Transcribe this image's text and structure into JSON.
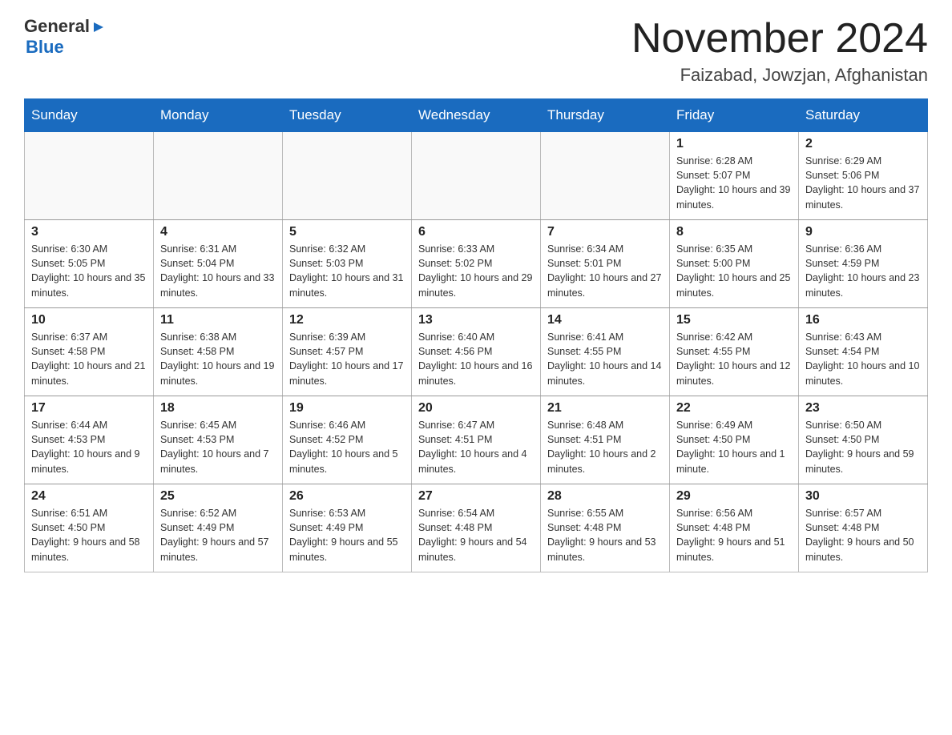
{
  "header": {
    "logo": {
      "general": "General",
      "triangle": "▶",
      "blue": "Blue"
    },
    "title": "November 2024",
    "location": "Faizabad, Jowzjan, Afghanistan"
  },
  "weekdays": [
    "Sunday",
    "Monday",
    "Tuesday",
    "Wednesday",
    "Thursday",
    "Friday",
    "Saturday"
  ],
  "weeks": [
    [
      {
        "day": "",
        "info": ""
      },
      {
        "day": "",
        "info": ""
      },
      {
        "day": "",
        "info": ""
      },
      {
        "day": "",
        "info": ""
      },
      {
        "day": "",
        "info": ""
      },
      {
        "day": "1",
        "info": "Sunrise: 6:28 AM\nSunset: 5:07 PM\nDaylight: 10 hours and 39 minutes."
      },
      {
        "day": "2",
        "info": "Sunrise: 6:29 AM\nSunset: 5:06 PM\nDaylight: 10 hours and 37 minutes."
      }
    ],
    [
      {
        "day": "3",
        "info": "Sunrise: 6:30 AM\nSunset: 5:05 PM\nDaylight: 10 hours and 35 minutes."
      },
      {
        "day": "4",
        "info": "Sunrise: 6:31 AM\nSunset: 5:04 PM\nDaylight: 10 hours and 33 minutes."
      },
      {
        "day": "5",
        "info": "Sunrise: 6:32 AM\nSunset: 5:03 PM\nDaylight: 10 hours and 31 minutes."
      },
      {
        "day": "6",
        "info": "Sunrise: 6:33 AM\nSunset: 5:02 PM\nDaylight: 10 hours and 29 minutes."
      },
      {
        "day": "7",
        "info": "Sunrise: 6:34 AM\nSunset: 5:01 PM\nDaylight: 10 hours and 27 minutes."
      },
      {
        "day": "8",
        "info": "Sunrise: 6:35 AM\nSunset: 5:00 PM\nDaylight: 10 hours and 25 minutes."
      },
      {
        "day": "9",
        "info": "Sunrise: 6:36 AM\nSunset: 4:59 PM\nDaylight: 10 hours and 23 minutes."
      }
    ],
    [
      {
        "day": "10",
        "info": "Sunrise: 6:37 AM\nSunset: 4:58 PM\nDaylight: 10 hours and 21 minutes."
      },
      {
        "day": "11",
        "info": "Sunrise: 6:38 AM\nSunset: 4:58 PM\nDaylight: 10 hours and 19 minutes."
      },
      {
        "day": "12",
        "info": "Sunrise: 6:39 AM\nSunset: 4:57 PM\nDaylight: 10 hours and 17 minutes."
      },
      {
        "day": "13",
        "info": "Sunrise: 6:40 AM\nSunset: 4:56 PM\nDaylight: 10 hours and 16 minutes."
      },
      {
        "day": "14",
        "info": "Sunrise: 6:41 AM\nSunset: 4:55 PM\nDaylight: 10 hours and 14 minutes."
      },
      {
        "day": "15",
        "info": "Sunrise: 6:42 AM\nSunset: 4:55 PM\nDaylight: 10 hours and 12 minutes."
      },
      {
        "day": "16",
        "info": "Sunrise: 6:43 AM\nSunset: 4:54 PM\nDaylight: 10 hours and 10 minutes."
      }
    ],
    [
      {
        "day": "17",
        "info": "Sunrise: 6:44 AM\nSunset: 4:53 PM\nDaylight: 10 hours and 9 minutes."
      },
      {
        "day": "18",
        "info": "Sunrise: 6:45 AM\nSunset: 4:53 PM\nDaylight: 10 hours and 7 minutes."
      },
      {
        "day": "19",
        "info": "Sunrise: 6:46 AM\nSunset: 4:52 PM\nDaylight: 10 hours and 5 minutes."
      },
      {
        "day": "20",
        "info": "Sunrise: 6:47 AM\nSunset: 4:51 PM\nDaylight: 10 hours and 4 minutes."
      },
      {
        "day": "21",
        "info": "Sunrise: 6:48 AM\nSunset: 4:51 PM\nDaylight: 10 hours and 2 minutes."
      },
      {
        "day": "22",
        "info": "Sunrise: 6:49 AM\nSunset: 4:50 PM\nDaylight: 10 hours and 1 minute."
      },
      {
        "day": "23",
        "info": "Sunrise: 6:50 AM\nSunset: 4:50 PM\nDaylight: 9 hours and 59 minutes."
      }
    ],
    [
      {
        "day": "24",
        "info": "Sunrise: 6:51 AM\nSunset: 4:50 PM\nDaylight: 9 hours and 58 minutes."
      },
      {
        "day": "25",
        "info": "Sunrise: 6:52 AM\nSunset: 4:49 PM\nDaylight: 9 hours and 57 minutes."
      },
      {
        "day": "26",
        "info": "Sunrise: 6:53 AM\nSunset: 4:49 PM\nDaylight: 9 hours and 55 minutes."
      },
      {
        "day": "27",
        "info": "Sunrise: 6:54 AM\nSunset: 4:48 PM\nDaylight: 9 hours and 54 minutes."
      },
      {
        "day": "28",
        "info": "Sunrise: 6:55 AM\nSunset: 4:48 PM\nDaylight: 9 hours and 53 minutes."
      },
      {
        "day": "29",
        "info": "Sunrise: 6:56 AM\nSunset: 4:48 PM\nDaylight: 9 hours and 51 minutes."
      },
      {
        "day": "30",
        "info": "Sunrise: 6:57 AM\nSunset: 4:48 PM\nDaylight: 9 hours and 50 minutes."
      }
    ]
  ]
}
